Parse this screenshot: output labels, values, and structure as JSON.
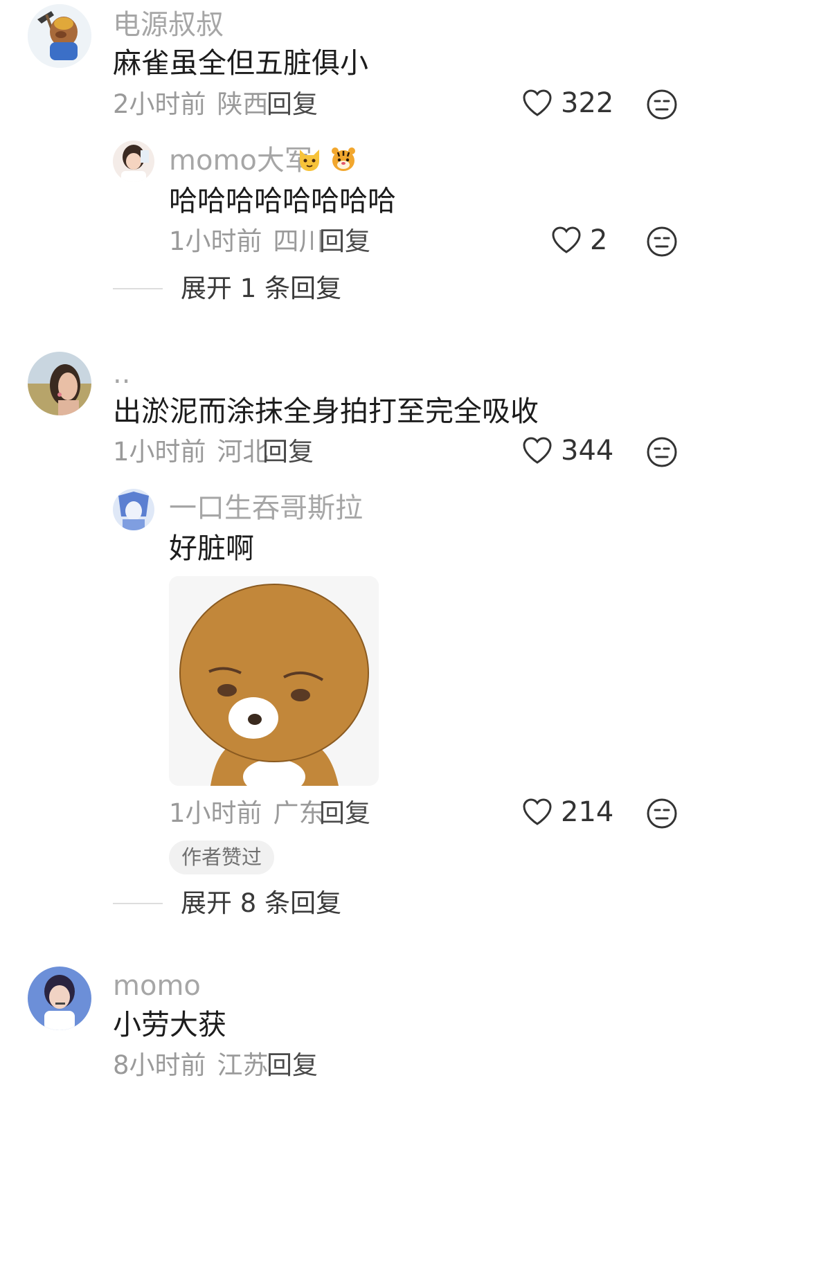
{
  "comments": [
    {
      "username": "电源叔叔",
      "text": "麻雀虽全但五脏俱小",
      "time": "2小时前",
      "location": "陕西",
      "reply_label": "回复",
      "likes": "322",
      "replies": [
        {
          "username": "momo大军",
          "badge_icons": [
            "cat-emoji-icon",
            "tiger-emoji-icon"
          ],
          "text": "哈哈哈哈哈哈哈哈",
          "time": "1小时前",
          "location": "四川",
          "reply_label": "回复",
          "likes": "2"
        }
      ],
      "expand_label": "展开 1 条回复"
    },
    {
      "username": "..",
      "text": "出淤泥而涂抹全身拍打至完全吸收",
      "time": "1小时前",
      "location": "河北",
      "reply_label": "回复",
      "likes": "344",
      "replies": [
        {
          "username": "一口生吞哥斯拉",
          "text": "好脏啊",
          "sticker": "bear-sticker-image",
          "time": "1小时前",
          "location": "广东",
          "reply_label": "回复",
          "likes": "214",
          "tag": "作者赞过"
        }
      ],
      "expand_label": "展开 8 条回复"
    },
    {
      "username": "momo",
      "text": "小劳大获",
      "time": "8小时前",
      "location": "江苏",
      "reply_label": "回复"
    }
  ],
  "colors": {
    "username": "#a6a6a6",
    "text": "#1c1c1c",
    "meta": "#9a9a9a",
    "icon": "#333333"
  }
}
